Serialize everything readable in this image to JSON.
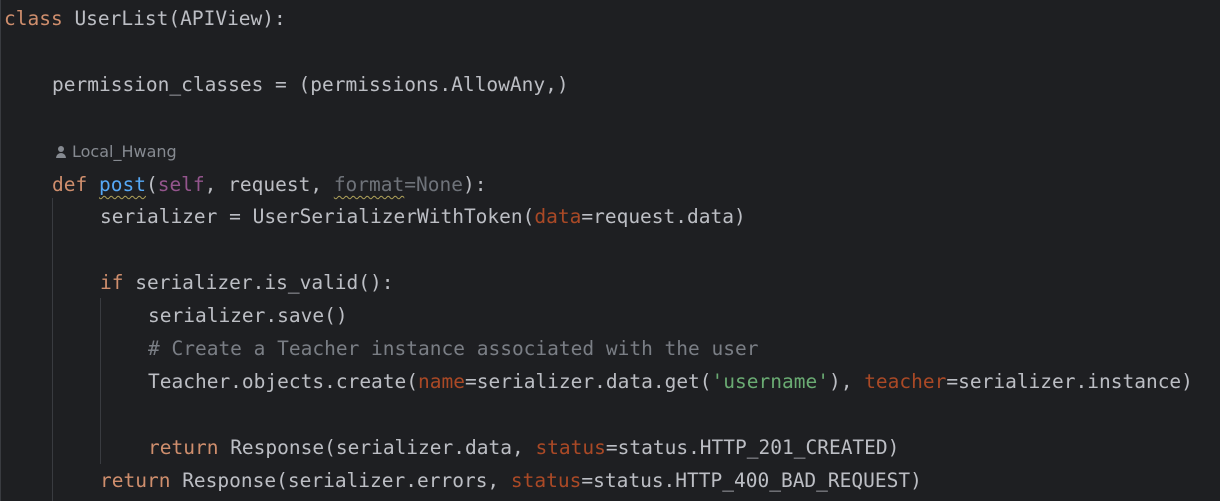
{
  "editor": {
    "colors": {
      "background": "#1e1f22",
      "default_text": "#bcbec4",
      "keyword": "#cf8e6d",
      "function_name": "#56a8f5",
      "self": "#94558d",
      "named_argument": "#aa4926",
      "string": "#6aab73",
      "comment": "#7a7e85"
    },
    "author_hint": {
      "icon": "user-icon",
      "author": "Local_Hwang"
    },
    "lines": {
      "l1": [
        "class",
        " UserList(APIView):"
      ],
      "l2": [
        "permission_classes = (permissions.AllowAny,)"
      ],
      "l3": [
        "def",
        " ",
        "post",
        "(",
        "self",
        ", request, ",
        "format",
        "=",
        "None",
        "):"
      ],
      "l4": [
        "serializer = UserSerializerWithToken(",
        "data",
        "=request.data)"
      ],
      "l5": [
        "if",
        " serializer.is_valid():"
      ],
      "l6": [
        "serializer.save()"
      ],
      "l7": [
        "# Create a Teacher instance associated with the user"
      ],
      "l8": [
        "Teacher.objects.create(",
        "name",
        "=serializer.data.get(",
        "'username'",
        "), ",
        "teacher",
        "=serializer.instance)"
      ],
      "l9": [
        "return",
        " Response(serializer.data, ",
        "status",
        "=status.HTTP_201_CREATED)"
      ],
      "l10": [
        "return",
        " Response(serializer.errors, ",
        "status",
        "=status.HTTP_400_BAD_REQUEST)"
      ]
    }
  }
}
